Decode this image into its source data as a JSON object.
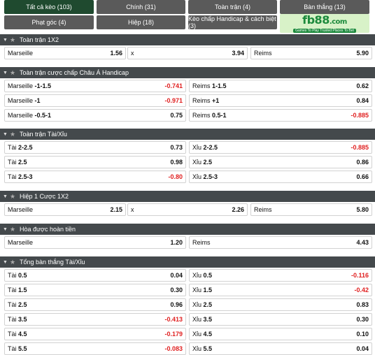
{
  "tabs": [
    {
      "label": "Tất cả kèo (103)",
      "active": true
    },
    {
      "label": "Chính (31)"
    },
    {
      "label": "Toàn trận (4)"
    },
    {
      "label": "Bàn thắng (13)"
    },
    {
      "label": "Phạt góc (4)"
    },
    {
      "label": "Hiệp (18)"
    },
    {
      "label": "Kèo chấp Handicap & cách biệt (3)"
    }
  ],
  "ad": {
    "logo": "fb88",
    "domain": ".com",
    "tagline": "Games To Play  Trusted Places To Bet"
  },
  "sections": [
    {
      "title": "Toàn trận 1X2",
      "rows": [
        [
          {
            "team": "Marseille",
            "line": "",
            "odds": "1.56"
          },
          {
            "team": "x",
            "line": "",
            "odds": "3.94"
          },
          {
            "team": "Reims",
            "line": "",
            "odds": "5.90"
          }
        ]
      ]
    },
    {
      "title": "Toàn trận cược chấp Châu Á Handicap",
      "rows": [
        [
          {
            "team": "Marseille",
            "line": "-1-1.5",
            "odds": "-0.741"
          },
          {
            "team": "Reims",
            "line": "1-1.5",
            "odds": "0.62"
          }
        ],
        [
          {
            "team": "Marseille",
            "line": "-1",
            "odds": "-0.971"
          },
          {
            "team": "Reims",
            "line": "+1",
            "odds": "0.84"
          }
        ],
        [
          {
            "team": "Marseille",
            "line": "-0.5-1",
            "odds": "0.75"
          },
          {
            "team": "Reims",
            "line": "0.5-1",
            "odds": "-0.885"
          }
        ]
      ]
    },
    {
      "title": "Toàn trận Tài/Xỉu",
      "rows": [
        [
          {
            "team": "Tài",
            "line": "2-2.5",
            "odds": "0.73"
          },
          {
            "team": "Xỉu",
            "line": "2-2.5",
            "odds": "-0.885"
          }
        ],
        [
          {
            "team": "Tài",
            "line": "2.5",
            "odds": "0.98"
          },
          {
            "team": "Xỉu",
            "line": "2.5",
            "odds": "0.86"
          }
        ],
        [
          {
            "team": "Tài",
            "line": "2.5-3",
            "odds": "-0.80"
          },
          {
            "team": "Xỉu",
            "line": "2.5-3",
            "odds": "0.66"
          }
        ]
      ]
    },
    {
      "title": "Hiệp 1 Cược 1X2",
      "rows": [
        [
          {
            "team": "Marseille",
            "line": "",
            "odds": "2.15"
          },
          {
            "team": "x",
            "line": "",
            "odds": "2.26"
          },
          {
            "team": "Reims",
            "line": "",
            "odds": "5.80"
          }
        ]
      ]
    },
    {
      "title": "Hòa được hoàn tiền",
      "rows": [
        [
          {
            "team": "Marseille",
            "line": "",
            "odds": "1.20"
          },
          {
            "team": "Reims",
            "line": "",
            "odds": "4.43"
          }
        ]
      ]
    },
    {
      "title": "Tổng bàn thắng Tài/Xỉu",
      "rows": [
        [
          {
            "team": "Tài",
            "line": "0.5",
            "odds": "0.04"
          },
          {
            "team": "Xỉu",
            "line": "0.5",
            "odds": "-0.116"
          }
        ],
        [
          {
            "team": "Tài",
            "line": "1.5",
            "odds": "0.30"
          },
          {
            "team": "Xỉu",
            "line": "1.5",
            "odds": "-0.42"
          }
        ],
        [
          {
            "team": "Tài",
            "line": "2.5",
            "odds": "0.96"
          },
          {
            "team": "Xỉu",
            "line": "2.5",
            "odds": "0.83"
          }
        ],
        [
          {
            "team": "Tài",
            "line": "3.5",
            "odds": "-0.413"
          },
          {
            "team": "Xỉu",
            "line": "3.5",
            "odds": "0.30"
          }
        ],
        [
          {
            "team": "Tài",
            "line": "4.5",
            "odds": "-0.179"
          },
          {
            "team": "Xỉu",
            "line": "4.5",
            "odds": "0.10"
          }
        ],
        [
          {
            "team": "Tài",
            "line": "5.5",
            "odds": "-0.083"
          },
          {
            "team": "Xỉu",
            "line": "5.5",
            "odds": "0.04"
          }
        ]
      ]
    }
  ],
  "colors": {
    "header_bg": "#44494c",
    "active_tab": "#1f4a2f",
    "tab_bg": "#5a5a5a",
    "negative": "#e02020",
    "ad_bg": "#d8f2c8",
    "ad_brand": "#1c8a3c"
  }
}
